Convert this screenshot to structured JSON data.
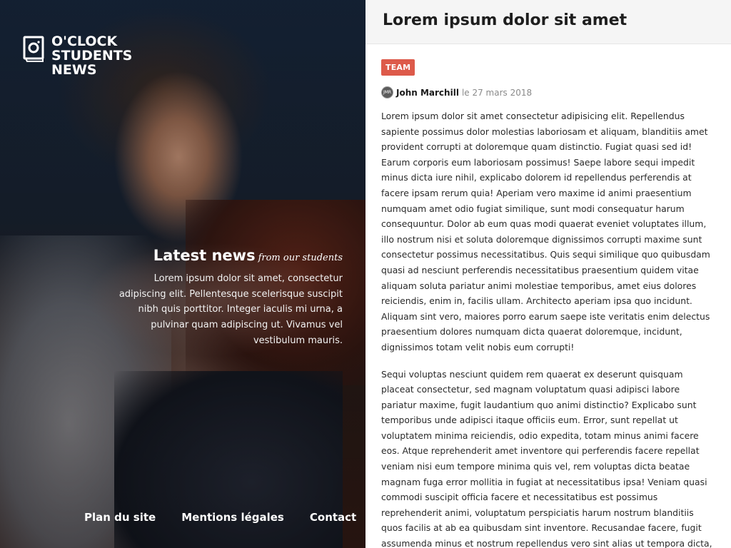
{
  "site": {
    "logo_lines": [
      "O'CLOCK",
      "STUDENTS",
      "NEWS"
    ]
  },
  "hero": {
    "title": "Latest news",
    "subtitle": "from our students",
    "description": "Lorem ipsum dolor sit amet, consectetur adipiscing elit. Pellentesque scelerisque suscipit nibh quis porttitor. Integer iaculis mi urna, a pulvinar quam adipiscing ut. Vivamus vel vestibulum mauris."
  },
  "footer": {
    "links": [
      "Plan du site",
      "Mentions légales",
      "Contact"
    ]
  },
  "article": {
    "title": "Lorem ipsum dolor sit amet",
    "tag": "TEAM",
    "avatar_initials": "JMR",
    "author": "John Marchill",
    "date": "le 27 mars 2018",
    "paragraphs": [
      "Lorem ipsum dolor sit amet consectetur adipisicing elit. Repellendus sapiente possimus dolor molestias laboriosam et aliquam, blanditiis amet provident corrupti at doloremque quam distinctio. Fugiat quasi sed id! Earum corporis eum laboriosam possimus! Saepe labore sequi impedit minus dicta iure nihil, explicabo dolorem id repellendus perferendis at facere ipsam rerum quia! Aperiam vero maxime id animi praesentium numquam amet odio fugiat similique, sunt modi consequatur harum consequuntur. Dolor ab eum quas modi quaerat eveniet voluptates illum, illo nostrum nisi et soluta doloremque dignissimos corrupti maxime sunt consectetur possimus necessitatibus. Quis sequi similique quo quibusdam quasi ad nesciunt perferendis necessitatibus praesentium quidem vitae aliquam soluta pariatur animi molestiae temporibus, amet eius dolores reiciendis, enim in, facilis ullam. Architecto aperiam ipsa quo incidunt. Aliquam sint vero, maiores porro earum saepe iste veritatis enim delectus praesentium dolores numquam dicta quaerat doloremque, incidunt, dignissimos totam velit nobis eum corrupti!",
      "Sequi voluptas nesciunt quidem rem quaerat ex deserunt quisquam placeat consectetur, sed magnam voluptatum quasi adipisci labore pariatur maxime, fugit laudantium quo animi distinctio? Explicabo sunt temporibus unde adipisci itaque officiis eum. Error, sunt repellat ut voluptatem minima reiciendis, odio expedita, totam minus animi facere eos. Atque reprehenderit amet inventore qui perferendis facere repellat veniam nisi eum tempore minima quis vel, rem voluptas dicta beatae magnam fuga error mollitia in fugiat at necessitatibus ipsa! Veniam quasi commodi suscipit officia facere et necessitatibus est possimus reprehenderit animi, voluptatum perspiciatis harum nostrum blanditiis quos facilis at ab ea quibusdam sint inventore. Recusandae facere, fugit assumenda minus et nostrum repellendus vero sint alias ut tempora dicta, esse dolores? Officiis aut eaque voluptatum non"
    ]
  },
  "colors": {
    "tag_bg": "#dd5a4a",
    "header_bg": "#f5f5f5"
  },
  "icons": {
    "logo": "notepad-camera-icon",
    "avatar": "author-avatar"
  }
}
